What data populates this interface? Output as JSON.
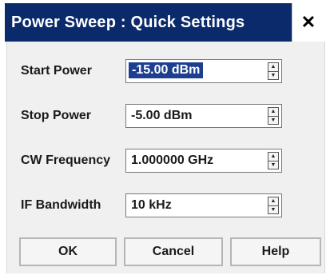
{
  "title": "Power Sweep : Quick Settings",
  "close_label": "✕",
  "fields": [
    {
      "label": "Start Power",
      "value": "-15.00 dBm",
      "selected": true
    },
    {
      "label": "Stop Power",
      "value": "-5.00 dBm",
      "selected": false
    },
    {
      "label": "CW Frequency",
      "value": "1.000000 GHz",
      "selected": false
    },
    {
      "label": "IF Bandwidth",
      "value": "10 kHz",
      "selected": false
    }
  ],
  "buttons": {
    "ok": "OK",
    "cancel": "Cancel",
    "help": "Help"
  },
  "colors": {
    "titlebar": "#0a2a6b",
    "selection": "#1c3f8f",
    "panel": "#f0f0f0"
  }
}
